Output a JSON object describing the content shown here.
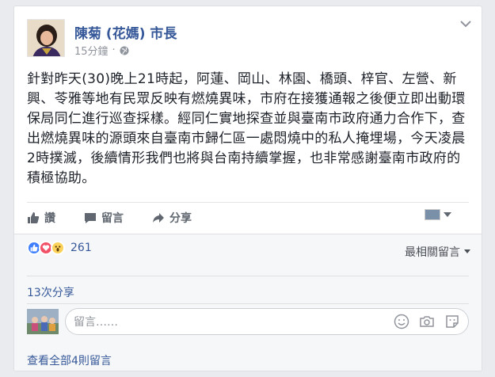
{
  "post": {
    "author": "陳菊 (花媽) 市長",
    "time": "15分鐘",
    "text": "針對昨天(30)晚上21時起，阿蓮、岡山、林園、橋頭、梓官、左營、新興、苓雅等地有民眾反映有燃燒異味，市府在接獲通報之後便立即出動環保局同仁進行巡查採樣。經同仁實地探查並與臺南市政府通力合作下，查出燃燒異味的源頭來自臺南市歸仁區一處悶燒中的私人掩埋場，今天凌晨2時撲滅，後續情形我們也將與台南持續掌握，也非常感謝臺南市政府的積極協助。"
  },
  "actions": {
    "like": "讚",
    "comment": "留言",
    "share": "分享"
  },
  "reactions": {
    "count": "261",
    "icons": [
      "like-icon",
      "love-icon",
      "wow-icon"
    ]
  },
  "comments": {
    "sort_label": "最相關留言",
    "shares": "13次分享",
    "placeholder": "留言……",
    "view_all": "查看全部4則留言"
  },
  "colors": {
    "link": "#365899",
    "like_blue": "#4080ff",
    "love_red": "#f25268",
    "wow_yellow": "#fcd25b"
  }
}
